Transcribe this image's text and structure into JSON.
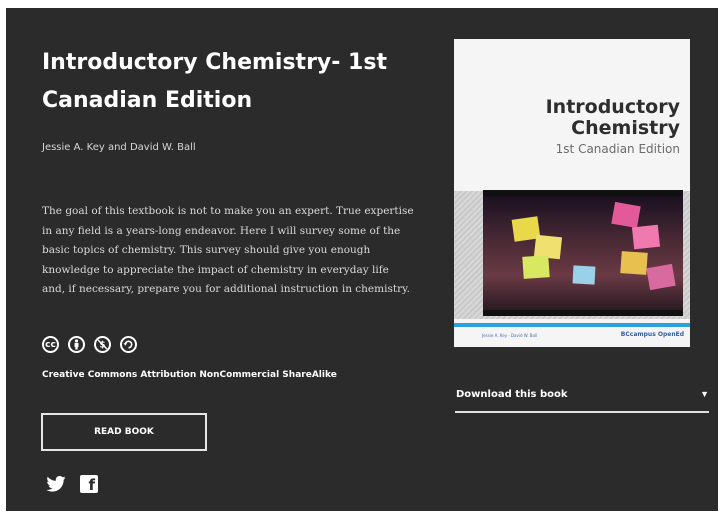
{
  "book": {
    "title": "Introductory Chemistry- 1st Canadian Edition",
    "authors": "Jessie A. Key and David W. Ball",
    "description": "The goal of this textbook is not to make you an expert. True expertise in any field is a years-long endeavor. Here I will survey some of the basic topics of chemistry. This survey should give you enough knowledge to appreciate the impact of chemistry in everyday life and, if necessary, prepare you for additional instruction in chemistry."
  },
  "license": {
    "icons": [
      "cc-icon",
      "attribution-icon",
      "noncommercial-icon",
      "sharealike-icon"
    ],
    "text": "Creative Commons Attribution NonCommercial ShareAlike"
  },
  "actions": {
    "read_label": "READ BOOK",
    "download_label": "Download this book"
  },
  "social": {
    "icons": [
      "twitter-icon",
      "facebook-icon"
    ],
    "facebook_glyph": "f"
  },
  "cover": {
    "title_line1": "Introductory",
    "title_line2": "Chemistry",
    "subtitle": "1st Canadian Edition",
    "authors_small": "Jessie A. Key · David W. Ball",
    "publisher": "BCcampus OpenEd"
  },
  "colors": {
    "background": "#2b2b2b",
    "text": "#ffffff",
    "cover_accent": "#2aa3dc"
  }
}
